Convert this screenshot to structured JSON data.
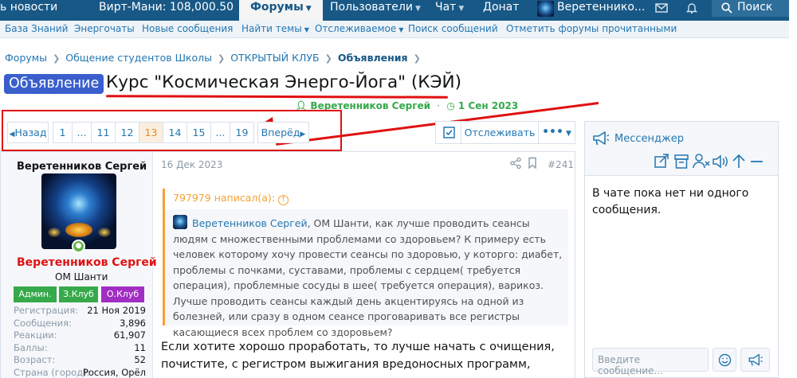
{
  "topnav": {
    "news_label": "ь новости",
    "money_label": "Вирт-Мани: 108,000.50",
    "forums_label": "Форумы",
    "users_label": "Пользователи",
    "chat_label": "Чат",
    "donate_label": "Донат",
    "account_name": "Веретеннико...",
    "search_label": "Поиск"
  },
  "subnav": {
    "items": [
      "База Знаний",
      "Энергочаты",
      "Новые сообщения",
      "Найти темы",
      "Отслеживаемое",
      "Поиск сообщений",
      "Отметить форумы прочитанными"
    ]
  },
  "breadcrumb": {
    "items": [
      "Форумы",
      "Общение студентов Школы",
      "ОТКРЫТЫЙ КЛУБ",
      "Объявления"
    ]
  },
  "thread": {
    "prefix": "Объявление",
    "title": "Курс \"Космическая Энерго-Йога\" (КЭЙ)",
    "author": "Веретенников Сергей",
    "date": "1 Сен 2023",
    "separator": "·"
  },
  "pagination": {
    "prev_label": "Назад",
    "next_label": "Вперёд",
    "pages": [
      "1",
      "...",
      "11",
      "12",
      "13",
      "14",
      "15",
      "...",
      "19"
    ],
    "current": "13"
  },
  "toolbar": {
    "follow_label": "Отслеживать",
    "more_label": "•••"
  },
  "post": {
    "user_name": "Веретенников Сергей",
    "user_title": "ОМ Шанти",
    "badges": [
      {
        "label": "Админ.",
        "color": "#36a94a"
      },
      {
        "label": "З.Клуб",
        "color": "#36a94a"
      },
      {
        "label": "О.Клуб",
        "color": "#a12ec2"
      }
    ],
    "stats": [
      {
        "label": "Регистрация:",
        "value": "21 Ноя 2019"
      },
      {
        "label": "Сообщения:",
        "value": "3,896"
      },
      {
        "label": "Реакции:",
        "value": "61,907"
      },
      {
        "label": "Баллы:",
        "value": "11"
      },
      {
        "label": "Возраст:",
        "value": "52"
      },
      {
        "label": "Страна (город):",
        "value": "Россия, Орёл"
      }
    ],
    "date": "16 Дек 2023",
    "number": "#241",
    "quote_author": "797979 написал(а):",
    "quote_mention": "Веретенников Сергей",
    "quote_text": ", ОМ Шанти, как лучше проводить сеансы людям с множественными проблемами со здоровьем? К примеру есть человек которому хочу провести сеансы по здоровью, у которго: диабет, проблемы с почками, суставами, проблемы с сердцем( требуется операция), проблемные сосуды в шее( требуется операция), варикоз. Лучше проводить сеансы каждый день акцентируясь на одной из болезней, или сразу в одном сеансе проговаривать все регистры касающиеся всех проблем со здоровьем?",
    "body_text": "Если хотите хорошо проработать, то лучше начать с очищения, почистите, с регистром выжигания вредоносных программ, отсекания вампирящих каналов"
  },
  "messenger": {
    "title": "Мессенджер",
    "empty_text": "В чате пока нет ни одного сообщения.",
    "input_placeholder": "Введите сообщение..."
  },
  "colors": {
    "nav_bg": "#185886",
    "link": "#2577b1",
    "prefix_bg": "#3a5fcd",
    "user_red": "#e01111",
    "quote_accent": "#f6a033",
    "annotation_red": "#e01010",
    "current_page": "#e08a2a"
  }
}
